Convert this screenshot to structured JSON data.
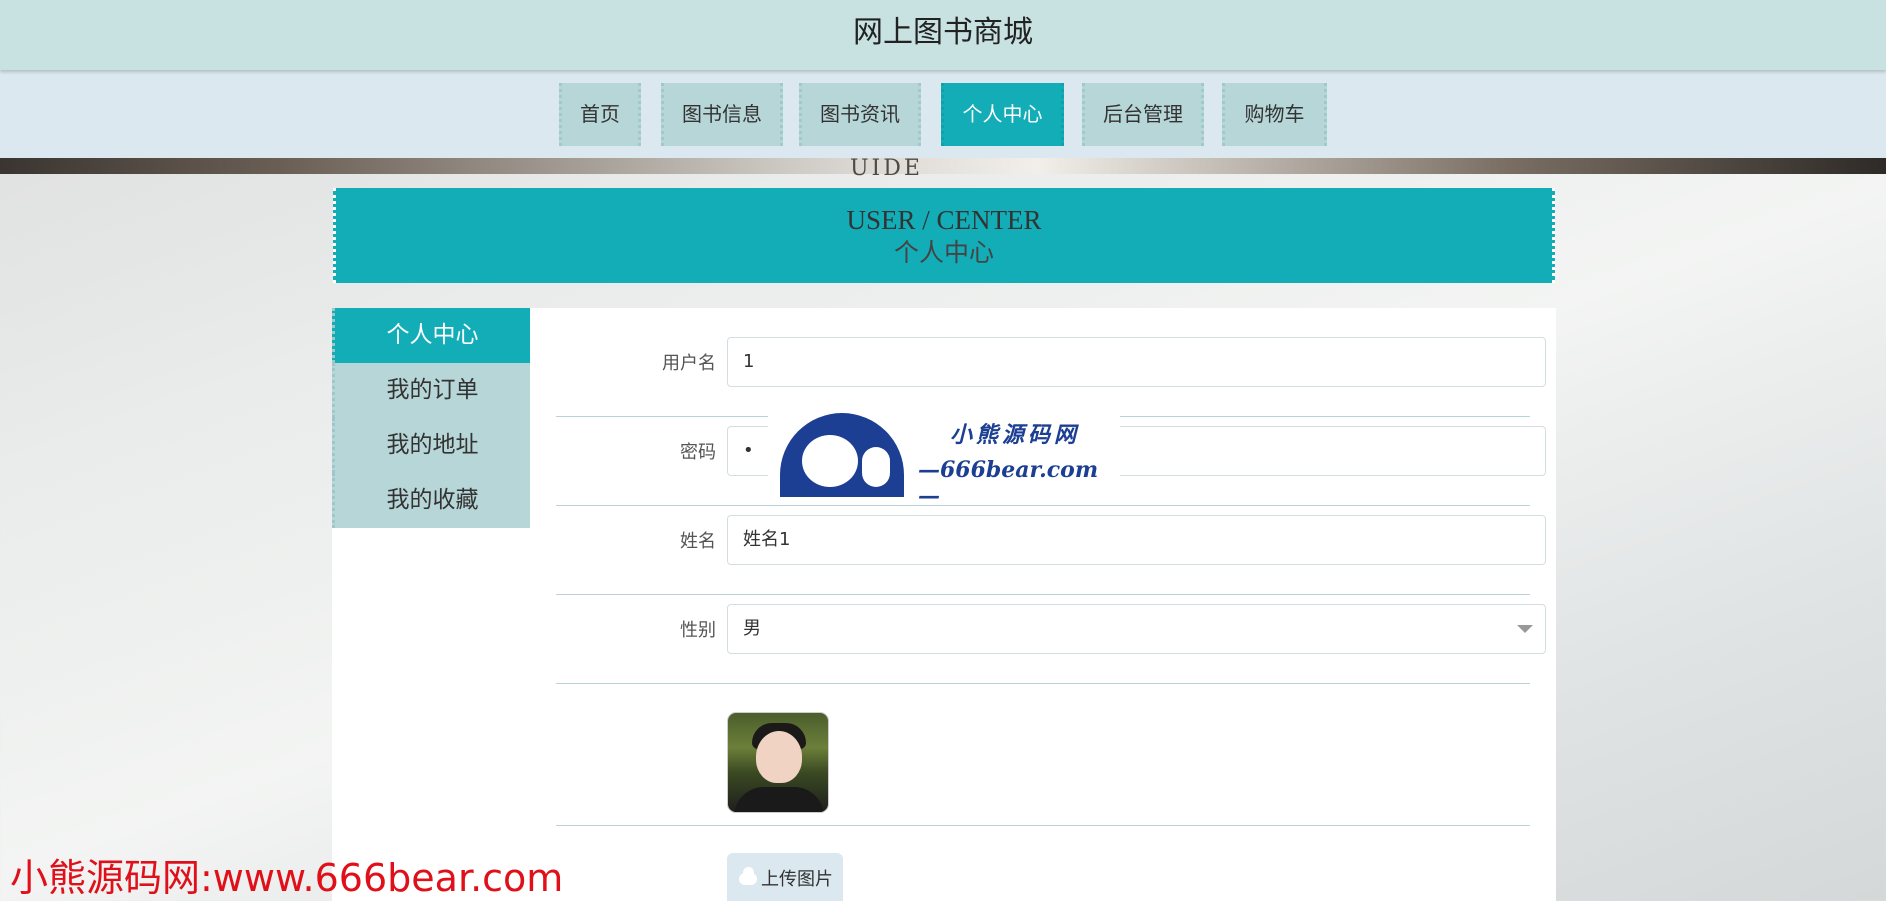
{
  "header": {
    "title": "网上图书商城"
  },
  "nav": {
    "items": [
      {
        "label": "首页"
      },
      {
        "label": "图书信息"
      },
      {
        "label": "图书资讯"
      },
      {
        "label": "个人中心"
      },
      {
        "label": "后台管理"
      },
      {
        "label": "购物车"
      }
    ],
    "active": "个人中心"
  },
  "banner": {
    "partial_text": "UIDE"
  },
  "section": {
    "en": "USER / CENTER",
    "cn": "个人中心"
  },
  "sidebar": {
    "items": [
      {
        "label": "个人中心"
      },
      {
        "label": "我的订单"
      },
      {
        "label": "我的地址"
      },
      {
        "label": "我的收藏"
      }
    ],
    "active": "个人中心"
  },
  "form": {
    "username": {
      "label": "用户名",
      "value": "1"
    },
    "password": {
      "label": "密码",
      "value": "•"
    },
    "name": {
      "label": "姓名",
      "value": "姓名1"
    },
    "gender": {
      "label": "性别",
      "value": "男"
    },
    "upload_label": "上传图片"
  },
  "watermark": {
    "logo_title": "小熊源码网",
    "logo_url": "—666bear.com—",
    "bottom_text": "小熊源码网:www.666bear.com"
  },
  "colors": {
    "accent": "#13adb8",
    "nav_bg": "#b7d6d7",
    "topbar": "#c8e1e1",
    "watermark_red": "#e0101a",
    "logo_blue": "#1c3f93"
  }
}
